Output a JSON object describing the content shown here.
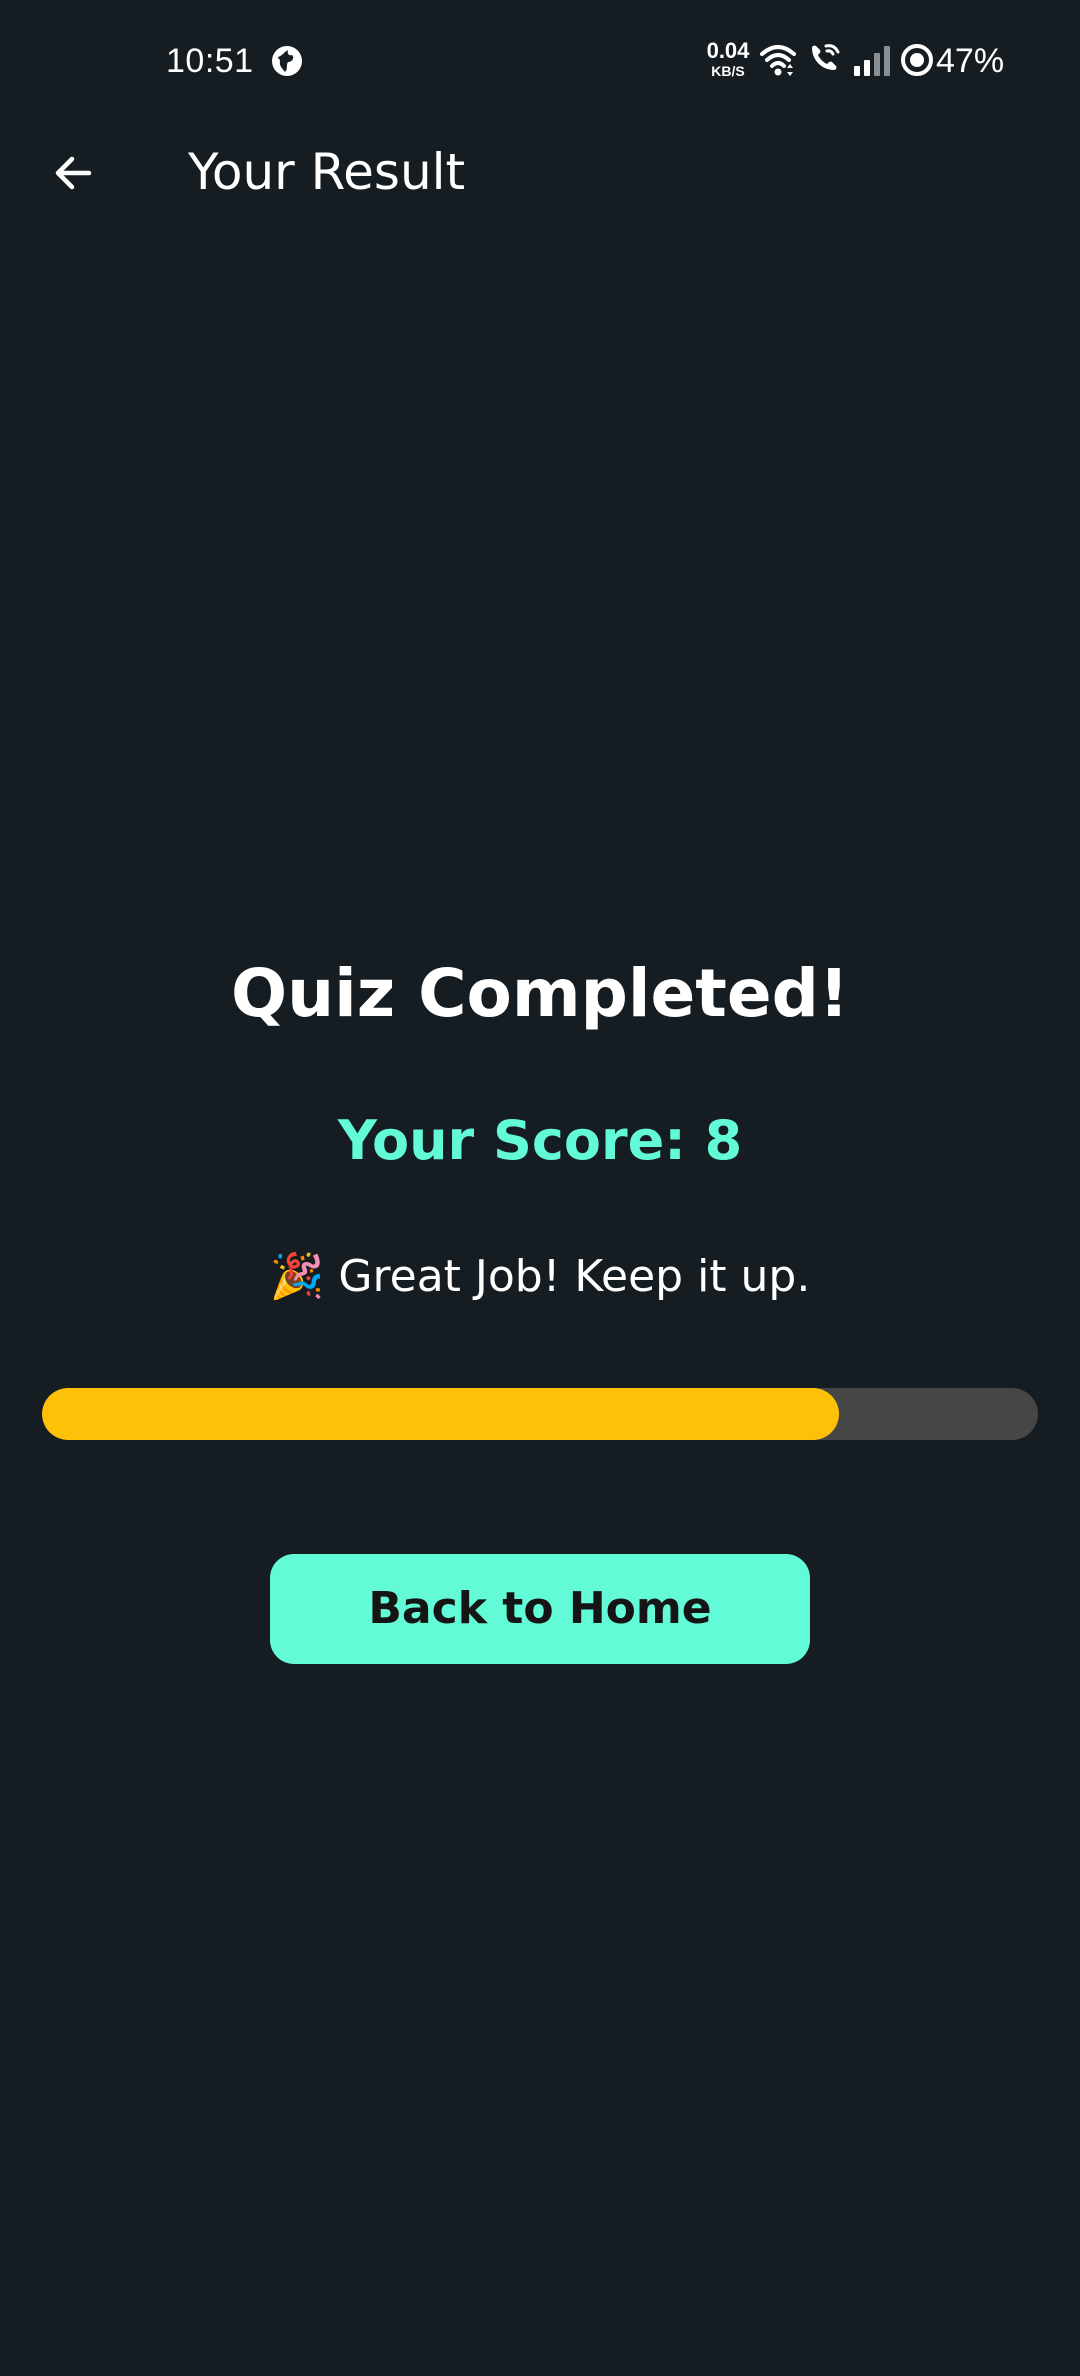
{
  "status_bar": {
    "time": "10:51",
    "net_speed_value": "0.04",
    "net_speed_unit": "KB/S",
    "battery": "47%",
    "icons": [
      "vpn-icon",
      "wifi-icon",
      "wifi-call-icon",
      "signal-icon",
      "battery-icon"
    ]
  },
  "app_bar": {
    "back_icon": "arrow-left-icon",
    "title": "Your Result"
  },
  "result": {
    "heading": "Quiz Completed!",
    "score_text": "Your Score: 8",
    "message": "🎉 Great Job! Keep it up.",
    "progress_fraction": 0.8
  },
  "actions": {
    "home_button_label": "Back to Home"
  },
  "colors": {
    "background": "#151d22",
    "accent": "#63fbd7",
    "progress_fill": "#ffc107",
    "progress_track": "#464646",
    "text": "#ffffff"
  }
}
